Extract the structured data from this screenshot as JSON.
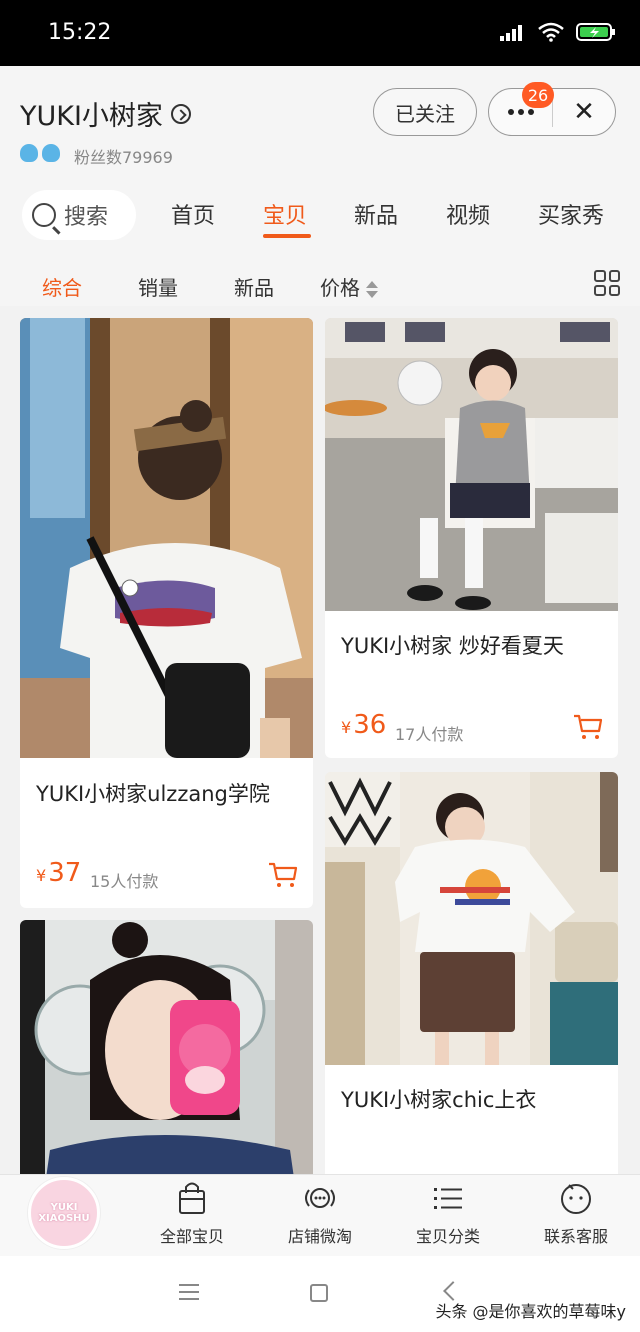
{
  "status_bar": {
    "time": "15:22"
  },
  "shop": {
    "name": "YUKI小树家",
    "fans": "粉丝数79969",
    "follow_label": "已关注",
    "badge_count": "26",
    "close_label": "✕"
  },
  "tabs": {
    "search_label": "搜索",
    "items": [
      {
        "label": "首页"
      },
      {
        "label": "宝贝"
      },
      {
        "label": "新品"
      },
      {
        "label": "视频"
      },
      {
        "label": "买家秀"
      }
    ],
    "active_index": 1
  },
  "sort": {
    "items": [
      {
        "label": "综合"
      },
      {
        "label": "销量"
      },
      {
        "label": "新品"
      },
      {
        "label": "价格"
      }
    ],
    "active_index": 0
  },
  "products": [
    {
      "title": "YUKI小树家ulzzang学院",
      "currency": "¥",
      "price": "37",
      "sold": "15人付款"
    },
    {
      "title": "YUKI小树家 炒好看夏天",
      "currency": "¥",
      "price": "36",
      "sold": "17人付款"
    },
    {
      "title": "YUKI小树家chic上衣",
      "currency": "¥",
      "price": "",
      "sold": ""
    },
    {
      "title": "",
      "currency": "",
      "price": "",
      "sold": ""
    }
  ],
  "bottom_nav": {
    "logo_line1": "YUKI",
    "logo_line2": "XIAOSHU",
    "items": [
      {
        "label": "全部宝贝",
        "icon": "bag-icon"
      },
      {
        "label": "店铺微淘",
        "icon": "broadcast-icon"
      },
      {
        "label": "宝贝分类",
        "icon": "list-icon"
      },
      {
        "label": "联系客服",
        "icon": "chat-face-icon"
      }
    ]
  },
  "watermark": "头条 @是你喜欢的草莓味y",
  "colors": {
    "accent": "#f05a1a",
    "badge": "#ff5a24"
  }
}
